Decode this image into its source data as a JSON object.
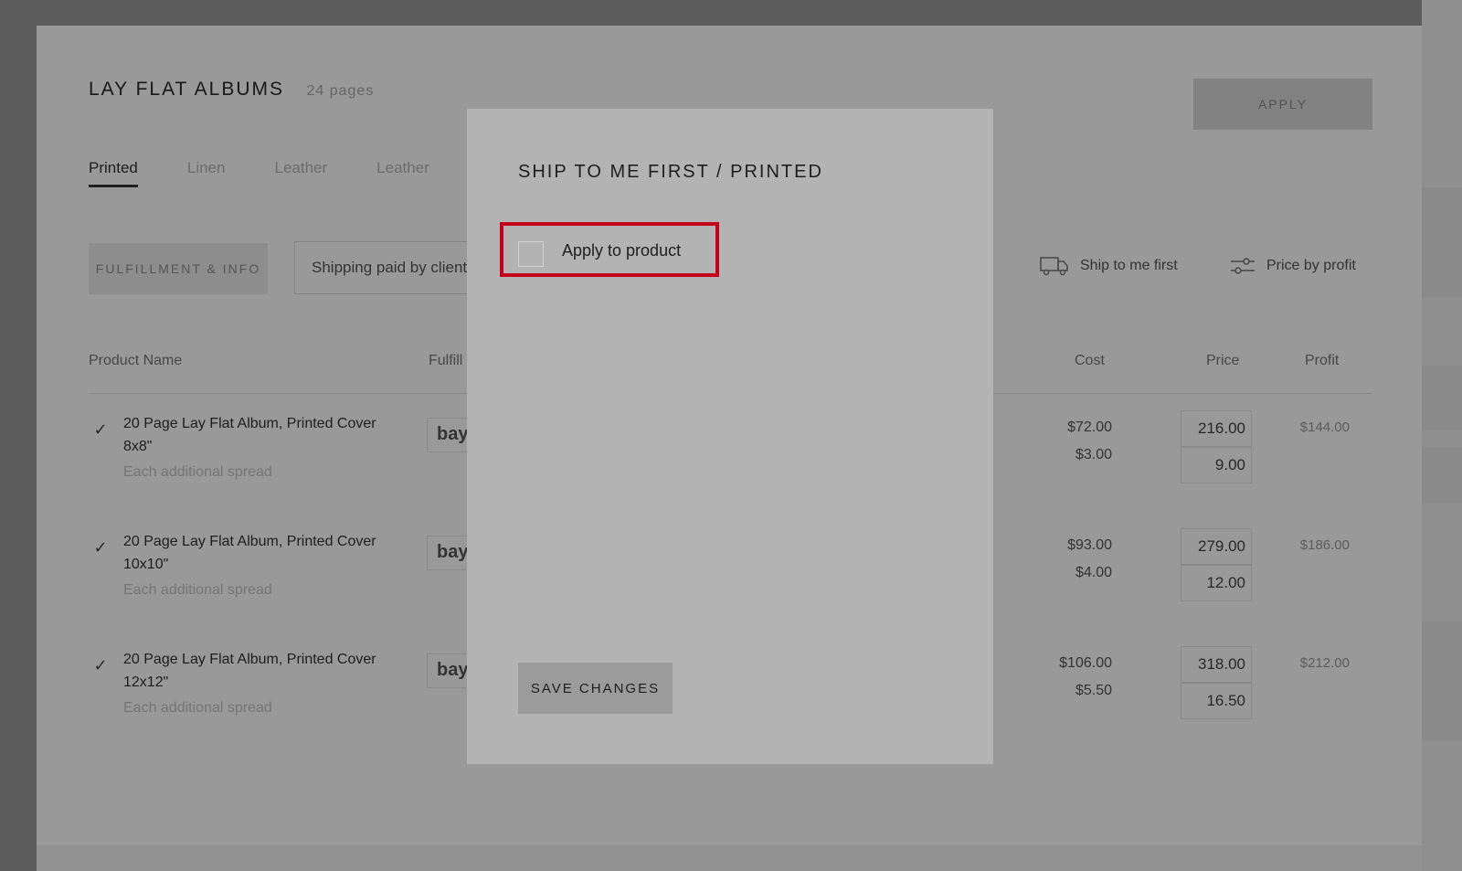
{
  "page": {
    "title": "LAY FLAT ALBUMS",
    "subtitle": "24 pages",
    "apply_label": "APPLY",
    "tabs": [
      {
        "label": "Printed"
      },
      {
        "label": "Linen"
      },
      {
        "label": "Leather"
      },
      {
        "label": "Leather"
      }
    ],
    "fulfillment_label": "FULFILLMENT & INFO",
    "shipping_value": "Shipping paid by client",
    "filters": {
      "partial_label": "r",
      "ship_first_label": "Ship to me first",
      "price_by_profit_label": "Price by profit"
    },
    "columns": {
      "product": "Product Name",
      "fulfillment": "Fulfill",
      "cost": "Cost",
      "price": "Price",
      "profit": "Profit"
    },
    "rows": [
      {
        "name": "20 Page Lay Flat Album, Printed Cover 8x8\"",
        "sub": "Each additional spread",
        "vendor": "bay",
        "cost": "$72.00",
        "cost_extra": "$3.00",
        "price": "216.00",
        "price_extra": "9.00",
        "profit": "$144.00"
      },
      {
        "name": "20 Page Lay Flat Album, Printed Cover 10x10\"",
        "sub": "Each additional spread",
        "vendor": "bay",
        "cost": "$93.00",
        "cost_extra": "$4.00",
        "price": "279.00",
        "price_extra": "12.00",
        "profit": "$186.00"
      },
      {
        "name": "20 Page Lay Flat Album, Printed Cover 12x12\"",
        "sub": "Each additional spread",
        "vendor": "bay",
        "cost": "$106.00",
        "cost_extra": "$5.50",
        "price": "318.00",
        "price_extra": "16.50",
        "profit": "$212.00"
      }
    ]
  },
  "modal": {
    "title": "SHIP TO ME FIRST / PRINTED",
    "apply_to_product_label": "Apply to product",
    "apply_to_product_checked": false,
    "save_label": "SAVE CHANGES"
  },
  "colors": {
    "highlight": "#c4001a",
    "overlay": "#000000"
  }
}
